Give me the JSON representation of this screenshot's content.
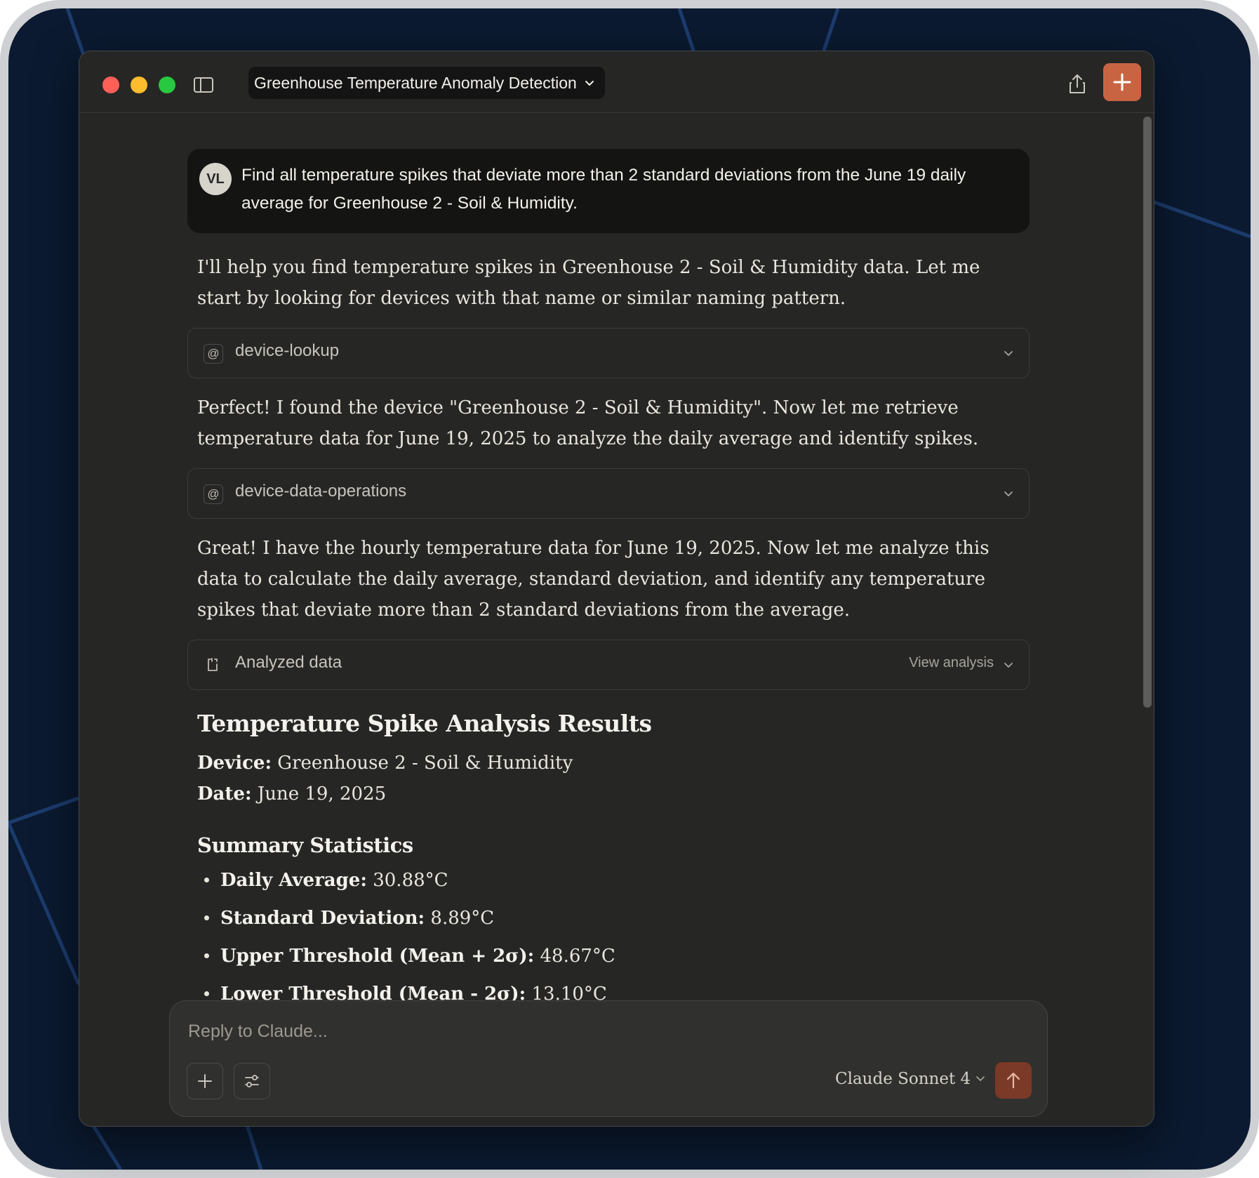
{
  "window": {
    "conversation_title": "Greenhouse Temperature Anomaly Detection"
  },
  "user_message": {
    "avatar_initials": "VL",
    "text": "Find all temperature spikes that deviate more than 2 standard deviations from the June 19 daily average for Greenhouse 2 - Soil & Humidity."
  },
  "assistant": {
    "para1": "I'll help you find temperature spikes in Greenhouse 2 - Soil & Humidity data. Let me start by looking for devices with that name or similar naming pattern.",
    "tool1": {
      "icon": "at-icon",
      "label": "device-lookup"
    },
    "para2": "Perfect! I found the device \"Greenhouse 2 - Soil & Humidity\". Now let me retrieve temperature data for June 19, 2025 to analyze the daily average and identify spikes.",
    "tool2": {
      "icon": "at-icon",
      "label": "device-data-operations"
    },
    "para3": "Great! I have the hourly temperature data for June 19, 2025. Now let me analyze this data to calculate the daily average, standard deviation, and identify any temperature spikes that deviate more than 2 standard deviations from the average.",
    "analysis": {
      "icon": "analysis-icon",
      "label": "Analyzed data",
      "view_label": "View analysis"
    },
    "results_heading": "Temperature Spike Analysis Results",
    "device_label": "Device:",
    "device_value": " Greenhouse 2 - Soil & Humidity",
    "date_label": "Date:",
    "date_value": " June 19, 2025",
    "summary_heading": "Summary Statistics",
    "stats": [
      {
        "label": "Daily Average:",
        "value": " 30.88°C"
      },
      {
        "label": "Standard Deviation:",
        "value": " 8.89°C"
      },
      {
        "label": "Upper Threshold (Mean + 2σ):",
        "value": " 48.67°C"
      },
      {
        "label": "Lower Threshold (Mean - 2σ):",
        "value": " 13.10°C"
      }
    ]
  },
  "composer": {
    "placeholder": "Reply to Claude...",
    "model": "Claude Sonnet 4"
  },
  "colors": {
    "accent": "#c96442",
    "window_bg": "#262625",
    "desktop_bg": "#0b1a30"
  }
}
